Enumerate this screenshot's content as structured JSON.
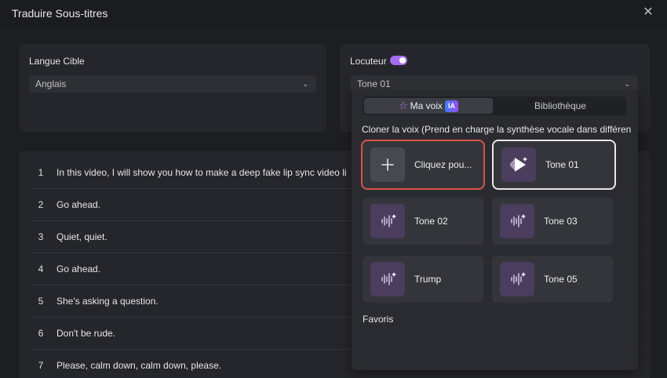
{
  "window": {
    "title": "Traduire Sous-titres"
  },
  "target_language": {
    "label": "Langue Cible",
    "value": "Anglais"
  },
  "speaker": {
    "label": "Locuteur",
    "toggle_on": true,
    "value": "Tone 01"
  },
  "voice_panel": {
    "tabs": [
      {
        "label": "Ma voix",
        "badge": "IA"
      },
      {
        "label": "Bibliothèque"
      }
    ],
    "clone_label": "Cloner la voix (Prend en charge la synthèse vocale dans différen",
    "cards": [
      {
        "name": "Cliquez pou...",
        "icon": "plus-icon",
        "selected": "red"
      },
      {
        "name": "Tone 01",
        "icon": "play-sparkle-icon",
        "selected": "white"
      },
      {
        "name": "Tone 02",
        "icon": "sound-wave-icon"
      },
      {
        "name": "Tone 03",
        "icon": "sound-wave-icon"
      },
      {
        "name": "Trump",
        "icon": "sound-wave-icon"
      },
      {
        "name": "Tone 05",
        "icon": "sound-wave-icon"
      }
    ],
    "favorites_label": "Favoris"
  },
  "subtitles": [
    {
      "num": "1",
      "text": "In this video, I will show you how to make a deep fake lip sync video li"
    },
    {
      "num": "2",
      "text": "Go ahead."
    },
    {
      "num": "3",
      "text": "Quiet, quiet."
    },
    {
      "num": "4",
      "text": "Go ahead."
    },
    {
      "num": "5",
      "text": "She's asking a question."
    },
    {
      "num": "6",
      "text": "Don't be rude."
    },
    {
      "num": "7",
      "text": "Please, calm down, calm down, please."
    }
  ],
  "colors": {
    "accent": "#a66bf2",
    "selected_outline": "#d9534a",
    "background": "#1d1e22",
    "panel": "#25262b"
  }
}
